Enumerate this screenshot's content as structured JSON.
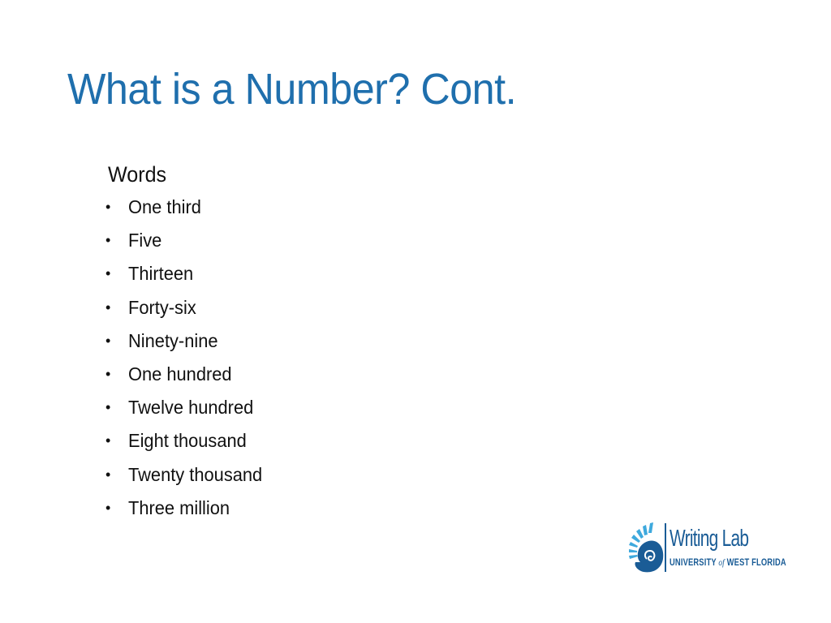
{
  "slide": {
    "title": "What is a Number? Cont.",
    "heading": "Words",
    "items": [
      "One third",
      "Five",
      "Thirteen",
      "Forty-six",
      "Ninety-nine",
      "One hundred",
      "Twelve hundred",
      "Eight thousand",
      "Twenty thousand",
      "Three million"
    ]
  },
  "logo": {
    "name": "Writing Lab",
    "sub_pre": "UNIVERSITY ",
    "sub_of": "of",
    "sub_post": " WEST FLORIDA",
    "icon": "nautilus-shell-icon",
    "colors": {
      "dark": "#1a5c96",
      "light": "#3ea9dd",
      "title": "#1f6fad"
    }
  }
}
